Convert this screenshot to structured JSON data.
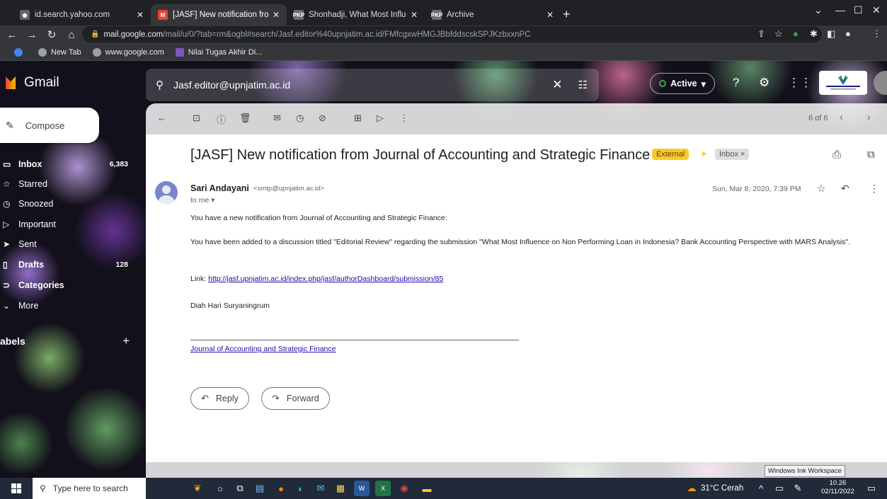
{
  "browser": {
    "tabs": [
      {
        "title": "id.search.yahoo.com",
        "icon": "globe-icon"
      },
      {
        "title": "[JASF] New notification from Jou",
        "icon": "gmail-icon"
      },
      {
        "title": "Shonhadji, What Most Influence",
        "icon": "pkp-icon"
      },
      {
        "title": "Archive",
        "icon": "pkp-icon"
      }
    ],
    "url_host": "mail.google.com",
    "url_path": "/mail/u/0/?tab=rm&ogbl#search/Jasf.editor%40upnjatim.ac.id/FMfcgxwHMGJBbfddscskSPJKzbxxnPC",
    "bookmarks": [
      "New Tab",
      "www.google.com",
      "Nilai Tugas Akhir Di..."
    ]
  },
  "gmail": {
    "logo_text": "Gmail",
    "search_value": "Jasf.editor@upnjatim.ac.id",
    "status": "Active",
    "compose_label": "Compose",
    "nav": [
      {
        "label": "Inbox",
        "count": "6,383",
        "icon": "inbox-icon",
        "bold": true
      },
      {
        "label": "Starred",
        "count": "",
        "icon": "star-icon",
        "bold": false
      },
      {
        "label": "Snoozed",
        "count": "",
        "icon": "clock-icon",
        "bold": false
      },
      {
        "label": "Important",
        "count": "",
        "icon": "important-icon",
        "bold": false
      },
      {
        "label": "Sent",
        "count": "",
        "icon": "send-icon",
        "bold": false
      },
      {
        "label": "Drafts",
        "count": "128",
        "icon": "draft-icon",
        "bold": true
      },
      {
        "label": "Categories",
        "count": "",
        "icon": "label-icon",
        "bold": true
      },
      {
        "label": "More",
        "count": "",
        "icon": "chevron-down-icon",
        "bold": false
      }
    ],
    "labels_header": "abels",
    "pager": "6 of 6"
  },
  "message": {
    "subject": "[JASF] New notification from Journal of Accounting and Strategic Finance",
    "tag_external": "External",
    "tag_inbox": "Inbox ×",
    "sender_name": "Sari Andayani",
    "sender_email": "<smtp@upnjatim.ac.id>",
    "to": "to me ▾",
    "date": "Sun, Mar 8, 2020, 7:39 PM",
    "line1": "You have a new notification from Journal of Accounting and Strategic Finance:",
    "line2": "You have been added to a discussion titled \"Editorial Review\" regarding the submission \"What Most Influence on Non Performing Loan in Indonesia? Bank Accounting Perspective with MARS Analysis\".",
    "link_label": "Link:",
    "link_url": "http://jasf.upnjatim.ac.id/index.php/jasf/authorDashboard/submission/85",
    "signature": "Diah Hari Suryaningrum",
    "footer_link": "Journal of Accounting and Strategic Finance",
    "reply_label": "Reply",
    "forward_label": "Forward"
  },
  "tooltip": "Windows Ink Workspace",
  "taskbar": {
    "search_placeholder": "Type here to search",
    "weather": "31°C Cerah",
    "time": "10.26",
    "date": "02/11/2022"
  }
}
